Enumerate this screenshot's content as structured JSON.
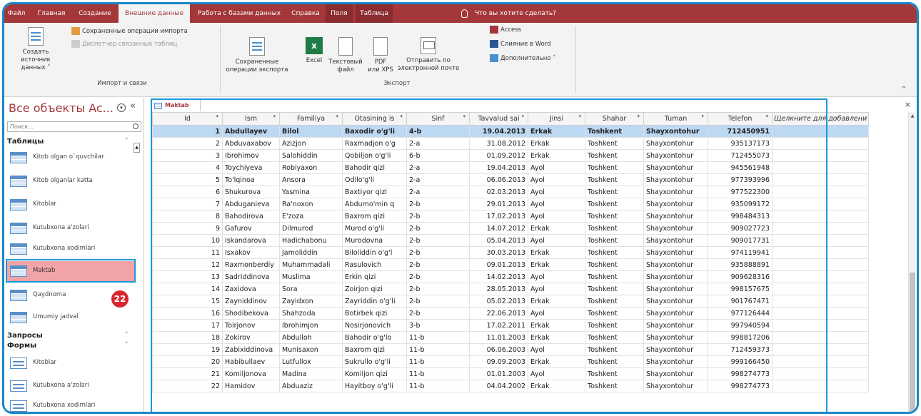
{
  "tabs": [
    {
      "label": "Файл",
      "active": false
    },
    {
      "label": "Главная",
      "active": false
    },
    {
      "label": "Создание",
      "active": false
    },
    {
      "label": "Внешние данные",
      "active": true
    },
    {
      "label": "Работа с базами данных",
      "active": false
    },
    {
      "label": "Справка",
      "active": false
    },
    {
      "label": "Поля",
      "active": false
    },
    {
      "label": "Таблица",
      "active": false
    }
  ],
  "tell_me": "Что вы хотите сделать?",
  "ribbon": {
    "import_group": {
      "create_source": "Создать источник",
      "create_source_2": "данных",
      "saved_imports": "Сохраненные операции импорта",
      "linked_manager": "Диспетчер связанных таблиц",
      "label": "Импорт и связи"
    },
    "export_group": {
      "saved_exports": "Сохраненные",
      "saved_exports_2": "операции экспорта",
      "excel": "Excel",
      "text_file": "Текстовый",
      "text_file_2": "файл",
      "pdf": "PDF",
      "pdf_2": "или XPS",
      "email": "Отправить по",
      "email_2": "электронной почте",
      "access": "Access",
      "word_merge": "Слияние в Word",
      "more": "Дополнительно",
      "label": "Экспорт"
    }
  },
  "nav": {
    "title": "Все объекты Ac...",
    "search_placeholder": "Поиск...",
    "sections": {
      "tables": "Таблицы",
      "queries": "Запросы",
      "forms": "Формы"
    },
    "tables": [
      "Kitob olgan o`quvchilar",
      "Kitob olganlar katta",
      "Kitoblar",
      "Kutubxona a'zolari",
      "Kutubxona xodimlari",
      "Maktab",
      "Qaydnoma",
      "Umumiy jadval"
    ],
    "forms": [
      "Kitoblar",
      "Kutubxona a'zolari",
      "Kutubxona xodimlari"
    ],
    "badge": "22"
  },
  "document": {
    "tab_label": "Maktab",
    "columns": [
      "Id",
      "Ism",
      "Familiya",
      "Otasining is",
      "Sinf",
      "Tavvalud sai",
      "Jinsi",
      "Shahar",
      "Tuman",
      "Telefon",
      "Щелкните для добавлени"
    ],
    "rows": [
      [
        "1",
        "Abdullayev",
        "Bilol",
        "Baxodir o'g'li",
        "4-b",
        "19.04.2013",
        "Erkak",
        "Toshkent",
        "Shayxontohur",
        "712450951"
      ],
      [
        "2",
        "Abduvaxabov",
        "Azizjon",
        "Raxmadjon o'g",
        "2-a",
        "31.08.2012",
        "Erkak",
        "Toshkent",
        "Shayxontohur",
        "935137173"
      ],
      [
        "3",
        "Ibrohimov",
        "Salohiddin",
        "Qobiljon o'g'li",
        "6-b",
        "01.09.2012",
        "Erkak",
        "Toshkent",
        "Shayxontohur",
        "712455073"
      ],
      [
        "4",
        "Toychiyeva",
        "Robiyaxon",
        "Bahodir qizi",
        "2-a",
        "19.04.2013",
        "Ayol",
        "Toshkent",
        "Shayxontohur",
        "945561948"
      ],
      [
        "5",
        "To'lqinoa",
        "Ansora",
        "Odilo'g'li",
        "2-a",
        "06.06.2013",
        "Ayol",
        "Toshkent",
        "Shayxontohur",
        "977393996"
      ],
      [
        "6",
        "Shukurova",
        "Yasmina",
        "Baxtiyor qizi",
        "2-a",
        "02.03.2013",
        "Ayol",
        "Toshkent",
        "Shayxontohur",
        "977522300"
      ],
      [
        "7",
        "Abduganieva",
        "Ra'noxon",
        "Abdumo'min q",
        "2-b",
        "29.01.2013",
        "Ayol",
        "Toshkent",
        "Shayxontohur",
        "935099172"
      ],
      [
        "8",
        "Bahodirova",
        "E'zoza",
        "Baxrom qizi",
        "2-b",
        "17.02.2013",
        "Ayol",
        "Toshkent",
        "Shayxontohur",
        "998484313"
      ],
      [
        "9",
        "Gafurov",
        "Dilmurod",
        "Murod o'g'li",
        "2-b",
        "14.07.2012",
        "Erkak",
        "Toshkent",
        "Shayxontohur",
        "909027723"
      ],
      [
        "10",
        "Iskandarova",
        "Hadichabonu",
        "Murodovna",
        "2-b",
        "05.04.2013",
        "Ayol",
        "Toshkent",
        "Shayxontohur",
        "909017731"
      ],
      [
        "11",
        "Isxakov",
        "Jamoliddin",
        "Biloliddin o'g'l",
        "2-b",
        "30.03.2013",
        "Erkak",
        "Toshkent",
        "Shayxontohur",
        "974119941"
      ],
      [
        "12",
        "Raxmonberdiy",
        "Muhammadali",
        "Rasulovich",
        "2-b",
        "09.01.2013",
        "Erkak",
        "Toshkent",
        "Shayxontohur",
        "935888891"
      ],
      [
        "13",
        "Sadriddinova",
        "Muslima",
        "Erkin qizi",
        "2-b",
        "14.02.2013",
        "Ayol",
        "Toshkent",
        "Shayxontohur",
        "909628316"
      ],
      [
        "14",
        "Zaxidova",
        "Sora",
        "Zoirjon qizi",
        "2-b",
        "28.05.2013",
        "Ayol",
        "Toshkent",
        "Shayxontohur",
        "998157675"
      ],
      [
        "15",
        "Zayniddinov",
        "Zayidxon",
        "Zayriddin o'g'li",
        "2-b",
        "05.02.2013",
        "Erkak",
        "Toshkent",
        "Shayxontohur",
        "901767471"
      ],
      [
        "16",
        "Shodibekova",
        "Shahzoda",
        "Botirbek qizi",
        "2-b",
        "22.06.2013",
        "Ayol",
        "Toshkent",
        "Shayxontohur",
        "977126444"
      ],
      [
        "17",
        "Toirjonov",
        "Ibrohimjon",
        "Nosirjonovich",
        "3-b",
        "17.02.2011",
        "Erkak",
        "Toshkent",
        "Shayxontohur",
        "997940594"
      ],
      [
        "18",
        "Zokirov",
        "Abdulloh",
        "Bahodir o'g'lo",
        "11-b",
        "11.01.2003",
        "Erkak",
        "Toshkent",
        "Shayxontohur",
        "998817206"
      ],
      [
        "19",
        "Zabixiddinova",
        "Munisaxon",
        "Baxrom qizi",
        "11-b",
        "06.06.2003",
        "Ayol",
        "Toshkent",
        "Shayxontohur",
        "712459373"
      ],
      [
        "20",
        "Habibullaev",
        "Lutfullox",
        "Sukrullo o'g'li",
        "11-b",
        "09.09.2003",
        "Erkak",
        "Toshkent",
        "Shayxontohur",
        "999166450"
      ],
      [
        "21",
        "Komiljonova",
        "Madina",
        "Komiljon qizi",
        "11-b",
        "01.01.2003",
        "Ayol",
        "Toshkent",
        "Shayxontohur",
        "998274773"
      ],
      [
        "22",
        "Hamidov",
        "Abduaziz",
        "Hayitboy o'g'li",
        "11-b",
        "04.04.2002",
        "Erkak",
        "Toshkent",
        "Shayxontohur",
        "998274773"
      ]
    ]
  },
  "colors": {
    "ribbon_tabs": "#a4373a",
    "accent_highlight": "#1a9ad6",
    "selected_nav": "#f2a3a8",
    "selected_row": "#bcd8f3",
    "badge": "#d8262f"
  }
}
